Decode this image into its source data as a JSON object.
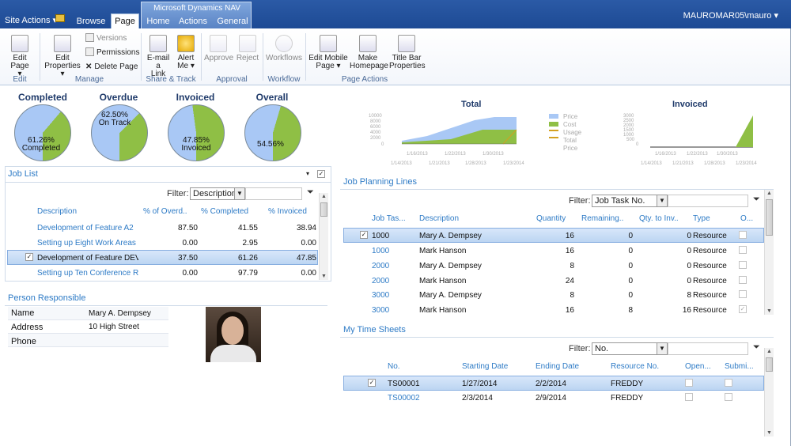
{
  "topbar": {
    "site_actions": "Site Actions",
    "tabs": [
      "Browse",
      "Page",
      "Home",
      "Actions",
      "General"
    ],
    "context_group": "Microsoft Dynamics NAV",
    "user": "MAUROMAR05\\mauro"
  },
  "ribbon": {
    "edit_page": "Edit Page",
    "edit_properties": [
      "Edit",
      "Properties"
    ],
    "versions": "Versions",
    "permissions": "Permissions",
    "delete_page": "Delete Page",
    "email_link": [
      "E-mail a",
      "Link"
    ],
    "alert_me": [
      "Alert",
      "Me"
    ],
    "approve": "Approve",
    "reject": "Reject",
    "workflows": "Workflows",
    "edit_mobile_page": [
      "Edit Mobile",
      "Page"
    ],
    "make_homepage": [
      "Make",
      "Homepage"
    ],
    "title_bar_properties": [
      "Title Bar",
      "Properties"
    ],
    "groups": [
      "Edit",
      "Manage",
      "Share & Track",
      "Approval",
      "Workflow",
      "Page Actions"
    ]
  },
  "pies": [
    {
      "title": "Completed",
      "label": [
        "61.26%",
        "Completed"
      ],
      "percent": 61.26
    },
    {
      "title": "Overdue",
      "label": [
        "62.50%",
        "On Track"
      ],
      "percent": 62.5
    },
    {
      "title": "Invoiced",
      "label": [
        "47.85%",
        "Invoiced"
      ],
      "percent": 47.85
    },
    {
      "title": "Overall",
      "label": [
        "54.56%"
      ],
      "percent": 54.56
    }
  ],
  "colors": {
    "green": "#8fbf45",
    "blue": "#a9c8f5",
    "accent": "#2e7bc6",
    "selected": "#bcd5f2"
  },
  "total_chart": {
    "title": "Total",
    "y_ticks": [
      "10000",
      "8000",
      "6000",
      "4000",
      "2000",
      "0"
    ],
    "x_ticks_top": [
      "1/16/2013",
      "1/22/2013",
      "1/30/2013"
    ],
    "x_ticks_bottom": [
      "1/14/2013",
      "1/21/2013",
      "1/28/2013",
      "1/23/2014"
    ],
    "legend": [
      "Price",
      "Cost",
      "Usage",
      "Total",
      "Price"
    ]
  },
  "invoiced_chart": {
    "title": "Invoiced",
    "y_ticks": [
      "3000",
      "2500",
      "2000",
      "1500",
      "1000",
      "500",
      "0"
    ],
    "x_ticks_top": [
      "1/16/2013",
      "1/22/2013",
      "1/30/2013"
    ],
    "x_ticks_bottom": [
      "1/14/2013",
      "1/21/2013",
      "1/28/2013",
      "1/23/2014"
    ]
  },
  "job_list": {
    "title": "Job List",
    "filter_label": "Filter:",
    "filter_value": "Description",
    "columns": [
      "Description",
      "% of Overd..",
      "% Completed",
      "% Invoiced"
    ],
    "rows": [
      {
        "description": "Development of Feature A2",
        "overdue": "87.50",
        "completed": "41.55",
        "invoiced": "38.94"
      },
      {
        "description": "Setting up Eight Work Areas",
        "overdue": "0.00",
        "completed": "2.95",
        "invoiced": "0.00"
      },
      {
        "description": "Development of Feature DEV",
        "overdue": "37.50",
        "completed": "61.26",
        "invoiced": "47.85"
      },
      {
        "description": "Setting up Ten Conference R",
        "overdue": "0.00",
        "completed": "97.79",
        "invoiced": "0.00"
      }
    ]
  },
  "person": {
    "title": "Person Responsible",
    "labels": [
      "Name",
      "Address",
      "Phone"
    ],
    "name": "Mary A. Dempsey",
    "address": "10 High Street",
    "phone": ""
  },
  "planning": {
    "title": "Job Planning Lines",
    "filter_label": "Filter:",
    "filter_value": "Job Task No.",
    "columns": [
      "Job Tas...",
      "Description",
      "Quantity",
      "Remaining..",
      "Qty. to Inv..",
      "Type",
      "O..."
    ],
    "rows": [
      {
        "task": "1000",
        "description": "Mary A. Dempsey",
        "quantity": "16",
        "remaining": "0",
        "qty_inv": "0",
        "type": "Resource"
      },
      {
        "task": "1000",
        "description": "Mark Hanson",
        "quantity": "16",
        "remaining": "0",
        "qty_inv": "0",
        "type": "Resource"
      },
      {
        "task": "2000",
        "description": "Mary A. Dempsey",
        "quantity": "8",
        "remaining": "0",
        "qty_inv": "0",
        "type": "Resource"
      },
      {
        "task": "2000",
        "description": "Mark Hanson",
        "quantity": "24",
        "remaining": "0",
        "qty_inv": "0",
        "type": "Resource"
      },
      {
        "task": "3000",
        "description": "Mary A. Dempsey",
        "quantity": "8",
        "remaining": "0",
        "qty_inv": "8",
        "type": "Resource"
      },
      {
        "task": "3000",
        "description": "Mark Hanson",
        "quantity": "16",
        "remaining": "8",
        "qty_inv": "16",
        "type": "Resource"
      }
    ]
  },
  "timesheets": {
    "title": "My Time Sheets",
    "filter_label": "Filter:",
    "filter_value": "No.",
    "columns": [
      "No.",
      "Starting Date",
      "Ending Date",
      "Resource No.",
      "Open...",
      "Submi..."
    ],
    "rows": [
      {
        "no": "TS00001",
        "start": "1/27/2014",
        "end": "2/2/2014",
        "resource": "FREDDY"
      },
      {
        "no": "TS00002",
        "start": "2/3/2014",
        "end": "2/9/2014",
        "resource": "FREDDY"
      }
    ]
  }
}
